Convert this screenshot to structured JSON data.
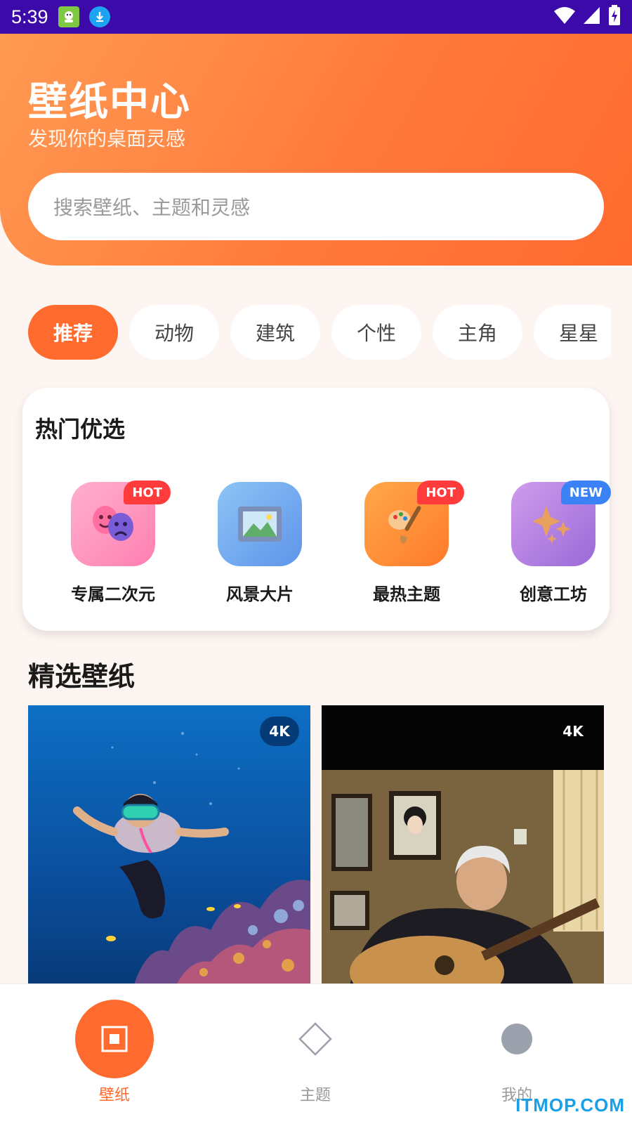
{
  "status_bar": {
    "time": "5:39",
    "icons": [
      "app-icon",
      "download-icon",
      "wifi-icon",
      "signal-icon",
      "battery-charging-icon"
    ]
  },
  "header": {
    "title": "壁纸中心",
    "subtitle": "发现你的桌面灵感",
    "search_placeholder": "搜索壁纸、主题和灵感"
  },
  "tabs": [
    {
      "label": "推荐",
      "active": true
    },
    {
      "label": "动物"
    },
    {
      "label": "建筑"
    },
    {
      "label": "个性"
    },
    {
      "label": "主角"
    },
    {
      "label": "星星"
    }
  ],
  "hot": {
    "title": "热门优选",
    "items": [
      {
        "label": "专属二次元",
        "badge": "HOT",
        "icon": "theater-masks-icon",
        "color": "#ff8fb8"
      },
      {
        "label": "风景大片",
        "badge": "",
        "icon": "framed-picture-icon",
        "color": "#6fa8ef"
      },
      {
        "label": "最热主题",
        "badge": "HOT",
        "icon": "paintbrush-icon",
        "color": "#ff8a3a"
      },
      {
        "label": "创意工坊",
        "badge": "NEW",
        "icon": "sparkles-icon",
        "color": "#b07ee0"
      }
    ]
  },
  "featured": {
    "title": "精选壁纸",
    "cards": [
      {
        "badge": "4K",
        "image": "underwater-diver-photo"
      },
      {
        "badge": "4K",
        "image": "elderly-guitarist-photo"
      }
    ]
  },
  "bottom_nav": [
    {
      "label": "壁纸",
      "icon": "square-icon",
      "active": true
    },
    {
      "label": "主题",
      "icon": "diamond-icon"
    },
    {
      "label": "我的",
      "icon": "circle-icon"
    }
  ],
  "watermark": "ITMOP.COM",
  "colors": {
    "accent": "#ff6a2e",
    "status_bar": "#3b0aa8",
    "background": "#fdf5f1"
  }
}
